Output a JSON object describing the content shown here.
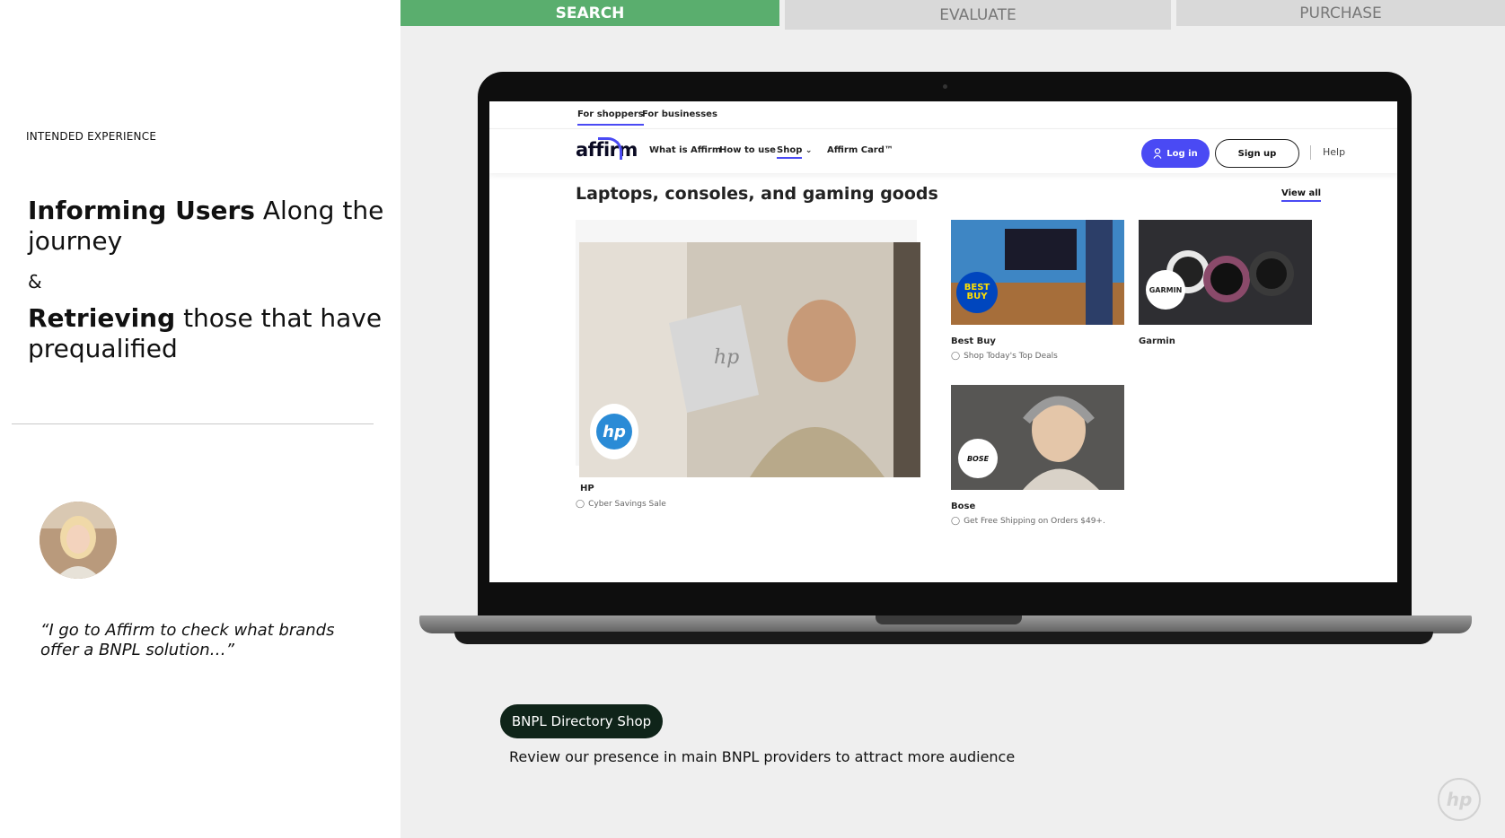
{
  "left_panel": {
    "eyebrow": "INTENDED EXPERIENCE",
    "headline_bold": "Informing Users",
    "headline_rest": " Along the journey",
    "ampersand": "&",
    "headline2_bold": "Retrieving",
    "headline2_rest": " those that have prequalified",
    "quote": "“I go to Affirm to check what brands offer a BNPL solution…”"
  },
  "stages": {
    "search": "SEARCH",
    "evaluate": "EVALUATE",
    "purchase": "PURCHASE"
  },
  "affirm_site": {
    "top_tabs": [
      "For shoppers",
      "For businesses"
    ],
    "logo_text": "affirm",
    "nav": [
      "What is Affirm",
      "How to use",
      "Shop",
      "Affirm Card™"
    ],
    "login": "Log in",
    "signup": "Sign up",
    "help": "Help",
    "section_title": "Laptops, consoles, and gaming goods",
    "view_all": "View all",
    "cards": {
      "hp": {
        "name": "HP",
        "deal": "Cyber Savings Sale",
        "logo": "hp"
      },
      "bestbuy": {
        "name": "Best Buy",
        "deal": "Shop Today's Top Deals",
        "logo": "BEST BUY"
      },
      "garmin": {
        "name": "Garmin",
        "logo": "GARMIN"
      },
      "bose": {
        "name": "Bose",
        "deal": "Get Free Shipping on Orders $49+.",
        "logo": "BOSE"
      }
    }
  },
  "callout": {
    "pill": "BNPL Directory Shop",
    "caption": "Review our presence in main BNPL providers to attract more audience"
  },
  "watermark": "hp",
  "colors": {
    "stage_active": "#5aae6e",
    "stage_inactive": "#d9d9d9",
    "affirm_blue": "#4a4af4",
    "pill_bg": "#0f2419"
  }
}
